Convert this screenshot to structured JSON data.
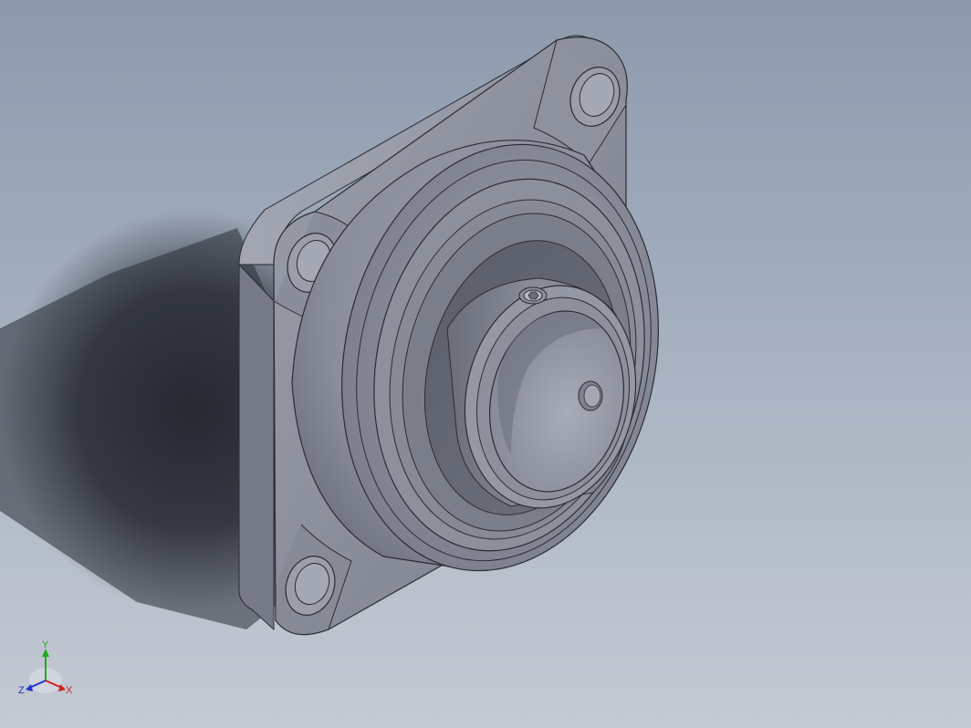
{
  "viewport": {
    "background_top": "#8c9aac",
    "background_bottom": "#c4cad4"
  },
  "model": {
    "part_color": "#8a8e9c",
    "edge_color": "#2a2c34"
  },
  "triad": {
    "x_label": "X",
    "y_label": "Y",
    "z_label": "Z",
    "x_color": "#cc2222",
    "y_color": "#22aa22",
    "z_color": "#2233cc"
  }
}
